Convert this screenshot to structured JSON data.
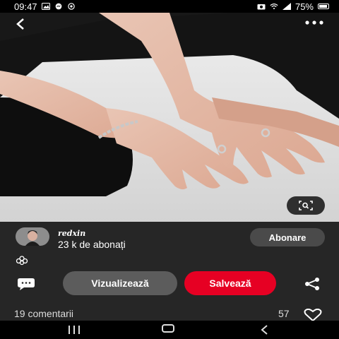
{
  "status_bar": {
    "time": "09:47",
    "battery_percent": "75%",
    "left_icons": [
      "image-icon",
      "messenger-icon",
      "whatsapp-icon"
    ],
    "right_icons": [
      "camera-icon",
      "wifi-icon",
      "signal-icon",
      "battery-icon"
    ]
  },
  "image_viewer": {
    "back_icon": "chevron-left-icon",
    "more_icon": "more-dots-icon",
    "visual_search_icon": "visual-search-icon"
  },
  "creator": {
    "username": "redxin",
    "subscribers": "23 k de abonați",
    "follow_label": "Abonare"
  },
  "actions": {
    "view_label": "Vizualizează",
    "save_label": "Salvează"
  },
  "footer": {
    "comments_label": "19 comentarii",
    "likes_count": "57"
  },
  "colors": {
    "accent_red": "#e60023",
    "panel_bg": "#262626",
    "button_gray": "#5c5c5c"
  }
}
